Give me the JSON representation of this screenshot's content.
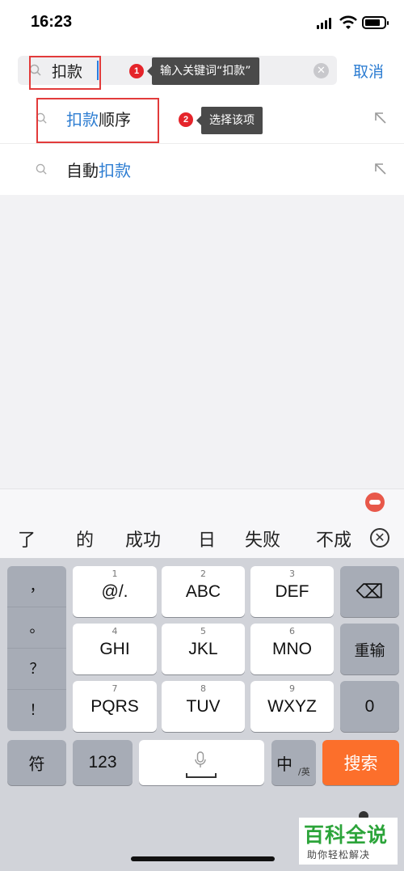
{
  "status_bar": {
    "time": "16:23"
  },
  "search": {
    "value": "扣款",
    "cancel_label": "取消",
    "clear_symbol": "✕"
  },
  "annotations": [
    {
      "step": "1",
      "tip": "输入关键词“扣款”"
    },
    {
      "step": "2",
      "tip": "选择该项"
    }
  ],
  "suggestions": [
    {
      "highlight": "扣款",
      "rest": "顺序",
      "prefix": ""
    },
    {
      "prefix": "自動",
      "highlight": "扣款",
      "rest": ""
    }
  ],
  "candidates": [
    "了",
    "的",
    "成功",
    "日",
    "失败",
    "不成"
  ],
  "candidate_close": "✕",
  "keyboard": {
    "punctuation": [
      "，",
      "。",
      "？",
      "！"
    ],
    "keys": [
      {
        "num": "1",
        "label": "@/."
      },
      {
        "num": "2",
        "label": "ABC"
      },
      {
        "num": "3",
        "label": "DEF"
      },
      {
        "num": "4",
        "label": "GHI"
      },
      {
        "num": "5",
        "label": "JKL"
      },
      {
        "num": "6",
        "label": "MNO"
      },
      {
        "num": "7",
        "label": "PQRS"
      },
      {
        "num": "8",
        "label": "TUV"
      },
      {
        "num": "9",
        "label": "WXYZ"
      }
    ],
    "delete_symbol": "⌫",
    "reenter_label": "重输",
    "zero_label": "0",
    "symbols_label": "符",
    "numbers_label": "123",
    "lang_main": "中",
    "lang_sub": "/英",
    "search_label": "搜索"
  },
  "watermark": {
    "title": "百科全说",
    "subtitle": "助你轻松解决"
  },
  "colors": {
    "accent": "#2d7dd2",
    "highlight_border": "#e23b3b",
    "search_key": "#fc6f2b",
    "watermark": "#2ca43a"
  }
}
